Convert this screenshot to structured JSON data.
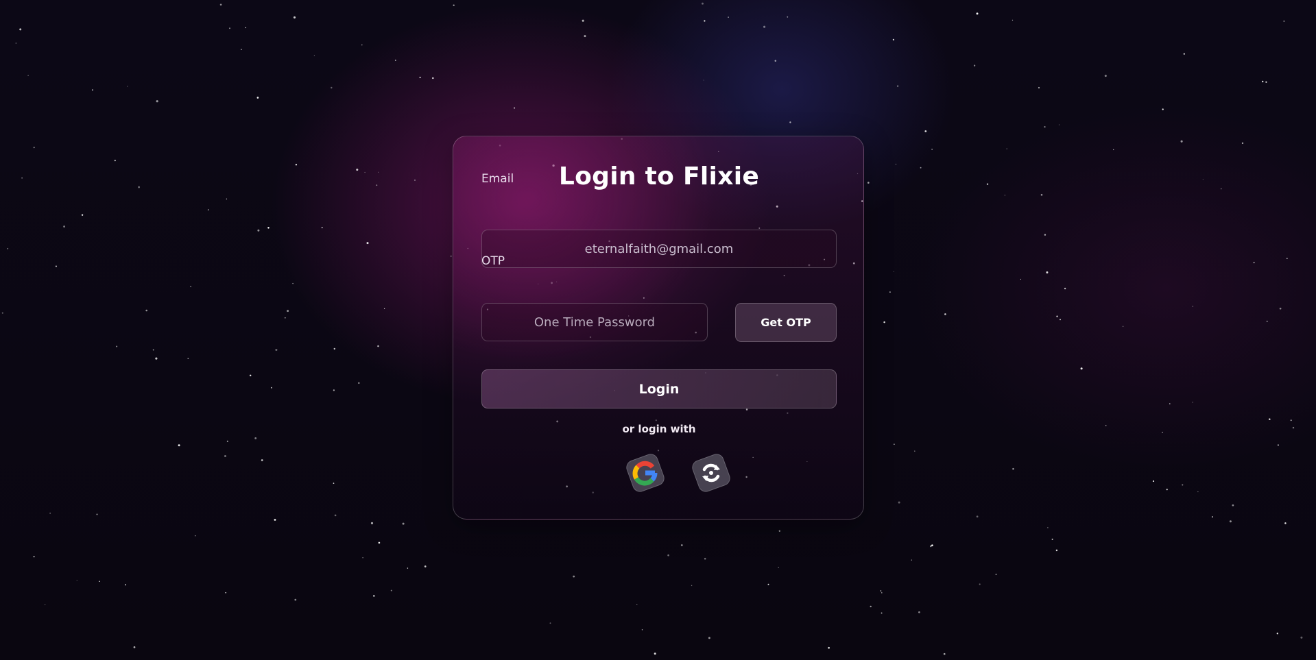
{
  "page": {
    "title": "Login to Flixie"
  },
  "form": {
    "email_label": "Email",
    "email_value": "eternalfaith@gmail.com",
    "otp_label": "OTP",
    "otp_placeholder": "One Time Password",
    "get_otp_label": "Get OTP",
    "login_label": "Login",
    "alt_login_text": "or login with"
  },
  "social": [
    {
      "icon": "google-icon"
    },
    {
      "icon": "refresh-cycle-icon"
    }
  ],
  "colors": {
    "background": "#0b0713",
    "accent_glow": "#8c186e",
    "google_red": "#ea4335",
    "google_yellow": "#fbbc05",
    "google_green": "#34a853",
    "google_blue": "#4285f4"
  }
}
